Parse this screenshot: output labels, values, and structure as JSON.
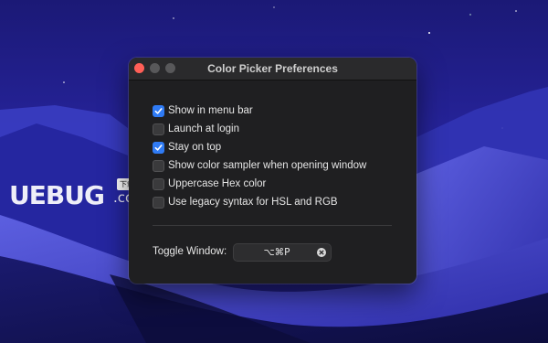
{
  "window": {
    "title": "Color Picker Preferences"
  },
  "options": [
    {
      "label": "Show in menu bar",
      "checked": true
    },
    {
      "label": "Launch at login",
      "checked": false
    },
    {
      "label": "Stay on top",
      "checked": true
    },
    {
      "label": "Show color sampler when opening window",
      "checked": false
    },
    {
      "label": "Uppercase Hex color",
      "checked": false
    },
    {
      "label": "Use legacy syntax for HSL and RGB",
      "checked": false
    }
  ],
  "toggle_window": {
    "label": "Toggle Window:",
    "shortcut": "⌥⌘P"
  },
  "watermark": {
    "text": "UEBUG",
    "suffix": ".com",
    "badge": "下载站"
  },
  "colors": {
    "accent": "#2f7bf5",
    "close": "#ff5f57",
    "window_bg": "#1f1f21",
    "wallpaper": "#1c1a7a"
  },
  "icons": {
    "checkmark": "checkmark-icon",
    "clear": "clear-circle-x-icon"
  }
}
